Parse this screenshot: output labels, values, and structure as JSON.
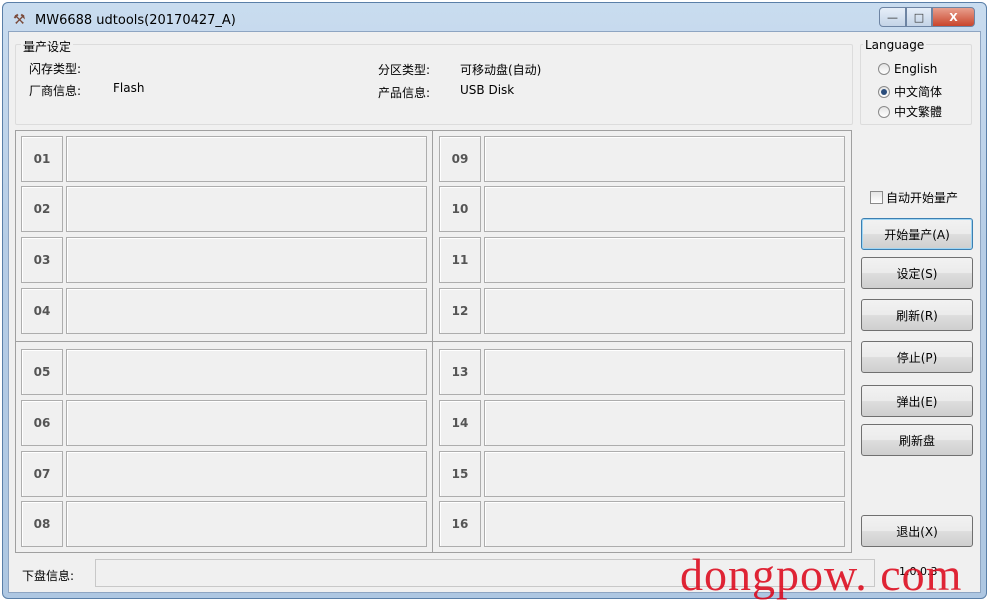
{
  "window": {
    "title": "MW6688 udtools(20170427_A)",
    "minimize": "—",
    "maximize": "□",
    "close": "X"
  },
  "settings": {
    "group_label": "量产设定",
    "flash_type_label": "闪存类型:",
    "flash_type_value": "",
    "vendor_label": "厂商信息:",
    "vendor_value": "Flash",
    "partition_label": "分区类型:",
    "partition_value": "可移动盘(自动)",
    "product_label": "产品信息:",
    "product_value": "USB Disk"
  },
  "language": {
    "group_label": "Language",
    "options": [
      {
        "label": "English",
        "selected": false
      },
      {
        "label": "中文简体",
        "selected": true
      },
      {
        "label": "中文繁體",
        "selected": false
      }
    ]
  },
  "slots": [
    "01",
    "02",
    "03",
    "04",
    "05",
    "06",
    "07",
    "08",
    "09",
    "10",
    "11",
    "12",
    "13",
    "14",
    "15",
    "16"
  ],
  "auto_start": {
    "label": "自动开始量产",
    "checked": false
  },
  "buttons": {
    "start": "开始量产(A)",
    "settings": "设定(S)",
    "refresh": "刷新(R)",
    "stop": "停止(P)",
    "eject": "弹出(E)",
    "refresh_disk": "刷新盘",
    "exit": "退出(X)"
  },
  "footer": {
    "label": "下盘信息:",
    "value": "",
    "version": "1.0.0.3"
  },
  "watermark": "dongpow. com"
}
